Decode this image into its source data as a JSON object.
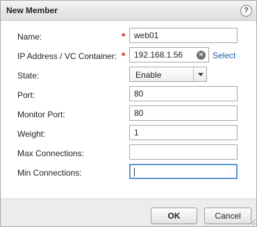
{
  "dialog": {
    "title": "New Member"
  },
  "form": {
    "name": {
      "label": "Name:",
      "value": "web01",
      "required": true
    },
    "ip": {
      "label": "IP Address / VC Container:",
      "value": "192.168.1.56",
      "required": true,
      "select_link": "Select"
    },
    "state": {
      "label": "State:",
      "value": "Enable"
    },
    "port": {
      "label": "Port:",
      "value": "80"
    },
    "monitor_port": {
      "label": "Monitor Port:",
      "value": "80"
    },
    "weight": {
      "label": "Weight:",
      "value": "1"
    },
    "max_connections": {
      "label": "Max Connections:",
      "value": ""
    },
    "min_connections": {
      "label": "Min Connections:",
      "value": ""
    }
  },
  "footer": {
    "ok_label": "OK",
    "cancel_label": "Cancel"
  },
  "icons": {
    "help": "help-icon",
    "clear": "clear-icon",
    "dropdown": "chevron-down-icon"
  },
  "colors": {
    "required": "#d42020",
    "link": "#1a5fa6",
    "focus": "#5b95d6"
  }
}
